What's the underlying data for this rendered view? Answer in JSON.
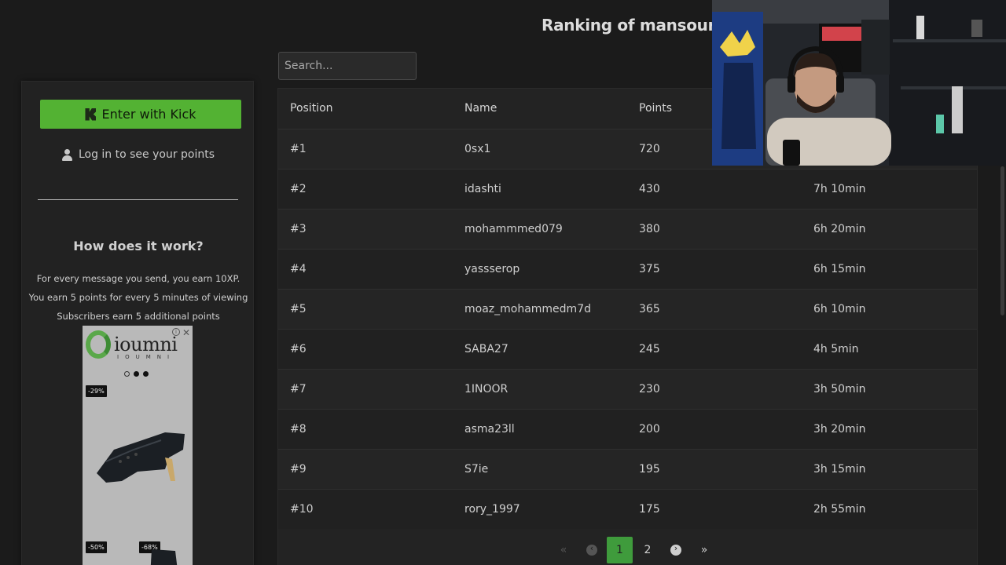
{
  "page": {
    "title": "Ranking of mansourtv"
  },
  "search": {
    "placeholder": "Search..."
  },
  "sidebar": {
    "kick_button_label": "Enter with Kick",
    "login_text": "Log in to see your points",
    "how_title": "How does it work?",
    "how_lines": [
      "For every message you send, you earn 10XP.",
      "You earn 5 points for every 5 minutes of viewing",
      "Subscribers earn 5 additional points"
    ]
  },
  "ad": {
    "brand": "ioumni",
    "brand_sub": "IOUMNI",
    "badges": [
      "-29%",
      "-50%",
      "-68%"
    ],
    "close": "✕",
    "info": "i"
  },
  "table": {
    "headers": [
      "Position",
      "Name",
      "Points",
      ""
    ],
    "rows": [
      {
        "position": "#1",
        "name": "0sx1",
        "points": "720",
        "time": ""
      },
      {
        "position": "#2",
        "name": "idashti",
        "points": "430",
        "time": "7h 10min"
      },
      {
        "position": "#3",
        "name": "mohammmed079",
        "points": "380",
        "time": "6h 20min"
      },
      {
        "position": "#4",
        "name": "yassserop",
        "points": "375",
        "time": "6h 15min"
      },
      {
        "position": "#5",
        "name": "moaz_mohammedm7d",
        "points": "365",
        "time": "6h 10min"
      },
      {
        "position": "#6",
        "name": "SABA27",
        "points": "245",
        "time": "4h 5min"
      },
      {
        "position": "#7",
        "name": "1INOOR",
        "points": "230",
        "time": "3h 50min"
      },
      {
        "position": "#8",
        "name": "asma23ll",
        "points": "200",
        "time": "3h 20min"
      },
      {
        "position": "#9",
        "name": "S7ie",
        "points": "195",
        "time": "3h 15min"
      },
      {
        "position": "#10",
        "name": "rory_1997",
        "points": "175",
        "time": "2h 55min"
      }
    ]
  },
  "pagination": {
    "first": "«",
    "prev": "‹",
    "pages": [
      "1",
      "2"
    ],
    "next": "›",
    "last": "»",
    "current": "1"
  },
  "colors": {
    "accent_green": "#53b233",
    "page_active": "#3f9b3c",
    "background": "#1b1b1b"
  }
}
